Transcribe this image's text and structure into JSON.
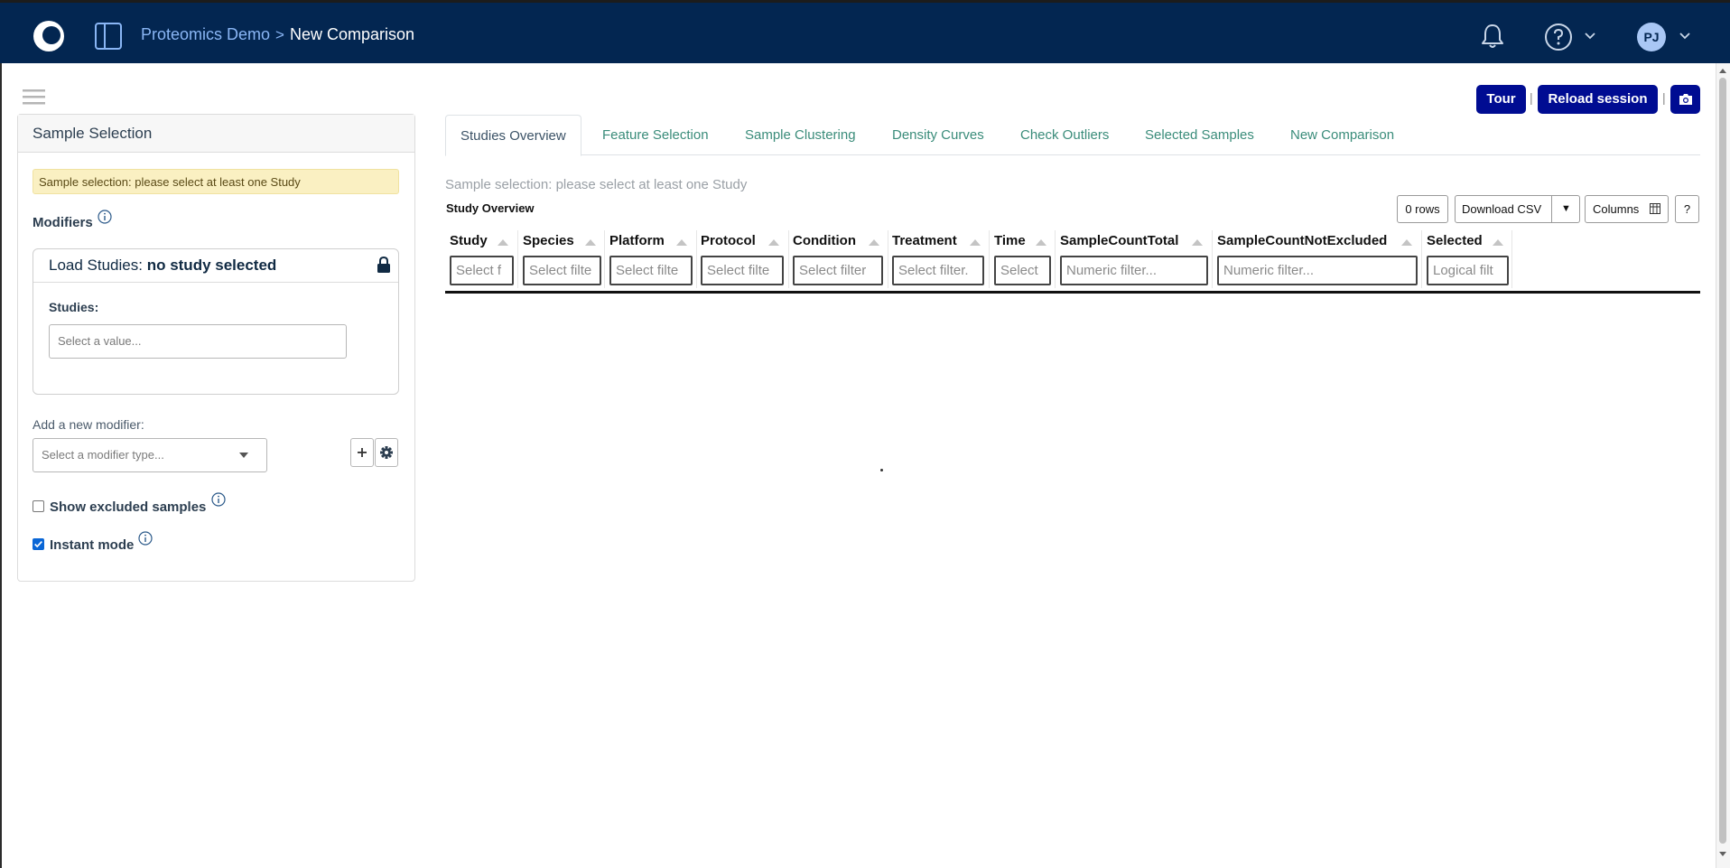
{
  "nav": {
    "project": "Proteomics Demo",
    "separator": ">",
    "current_page": "New Comparison",
    "user_initials": "PJ"
  },
  "actions": {
    "tour": "Tour",
    "reload": "Reload session",
    "pipe": "|"
  },
  "sidebar": {
    "title": "Sample Selection",
    "warning": "Sample selection: please select at least one Study",
    "modifiers_label": "Modifiers",
    "load_studies": {
      "title_prefix": "Load Studies:",
      "title_status": "no study selected",
      "studies_label": "Studies:",
      "studies_placeholder": "Select a value..."
    },
    "add_modifier_label": "Add a new modifier:",
    "modifier_placeholder": "Select a modifier type...",
    "show_excluded_label": "Show excluded samples",
    "show_excluded_checked": false,
    "instant_mode_label": "Instant mode",
    "instant_mode_checked": true
  },
  "tabs": [
    {
      "label": "Studies Overview",
      "active": true
    },
    {
      "label": "Feature Selection",
      "active": false
    },
    {
      "label": "Sample Clustering",
      "active": false
    },
    {
      "label": "Density Curves",
      "active": false
    },
    {
      "label": "Check Outliers",
      "active": false
    },
    {
      "label": "Selected Samples",
      "active": false
    },
    {
      "label": "New Comparison",
      "active": false
    }
  ],
  "main": {
    "hint": "Sample selection: please select at least one Study",
    "table_title": "Study Overview",
    "rows_count": "0 rows",
    "download_csv": "Download CSV",
    "csv_caret": "▼",
    "columns_btn": "Columns",
    "help_btn": "?"
  },
  "table": {
    "columns": [
      {
        "name": "Study",
        "filter": "Select f"
      },
      {
        "name": "Species",
        "filter": "Select filte"
      },
      {
        "name": "Platform",
        "filter": "Select filte"
      },
      {
        "name": "Protocol",
        "filter": "Select filte"
      },
      {
        "name": "Condition",
        "filter": "Select filter"
      },
      {
        "name": "Treatment",
        "filter": "Select filter."
      },
      {
        "name": "Time",
        "filter": "Select"
      },
      {
        "name": "SampleCountTotal",
        "filter": "Numeric filter..."
      },
      {
        "name": "SampleCountNotExcluded",
        "filter": "Numeric filter..."
      },
      {
        "name": "Selected",
        "filter": "Logical filt"
      }
    ],
    "rows": []
  },
  "colors": {
    "topbar": "#032651",
    "primary_button": "#000c92",
    "tab_link": "#3a8c7a",
    "warning_bg": "#faf0c2"
  }
}
